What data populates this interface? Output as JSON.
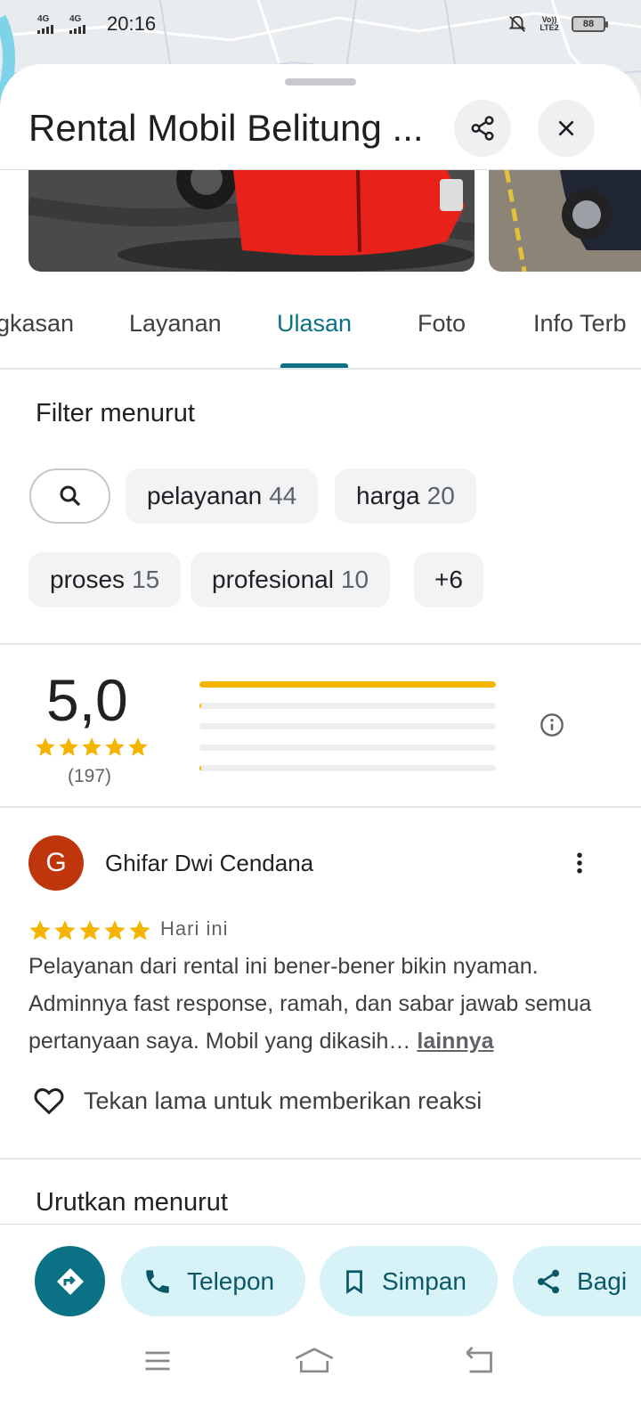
{
  "status_bar": {
    "net1": "4G",
    "net2": "4G",
    "time": "20:16",
    "volte": "Vo)) LTE2",
    "battery": "88"
  },
  "place": {
    "title": "Rental Mobil Belitung ..."
  },
  "tabs": [
    {
      "label": "gkasan"
    },
    {
      "label": "Layanan"
    },
    {
      "label": "Ulasan"
    },
    {
      "label": "Foto"
    },
    {
      "label": "Info Terb"
    }
  ],
  "filter": {
    "title": "Filter menurut",
    "chips": [
      {
        "label": "pelayanan",
        "count": "44"
      },
      {
        "label": "harga",
        "count": "20"
      },
      {
        "label": "proses",
        "count": "15"
      },
      {
        "label": "profesional",
        "count": "10"
      },
      {
        "label": "+6",
        "count": ""
      }
    ]
  },
  "rating": {
    "value": "5,0",
    "stars": 5,
    "count": "(197)",
    "distribution": [
      {
        "stars": 5,
        "fraction": 1.0
      },
      {
        "stars": 4,
        "fraction": 0.005
      },
      {
        "stars": 3,
        "fraction": 0.0
      },
      {
        "stars": 2,
        "fraction": 0.0
      },
      {
        "stars": 1,
        "fraction": 0.005
      }
    ],
    "bar_color": "#f4b400"
  },
  "review": {
    "avatar_letter": "G",
    "avatar_color": "#bf360c",
    "author": "Ghifar Dwi Cendana",
    "stars": 5,
    "date": "Hari ini",
    "text": "Pelayanan dari rental ini bener-bener bikin nyaman. Adminnya fast response, ramah, dan sabar jawab semua pertanyaan saya. Mobil yang dikasih…",
    "more_label": "lainnya",
    "reaction_hint": "Tekan lama untuk memberikan reaksi"
  },
  "sort": {
    "title": "Urutkan menurut"
  },
  "actions": {
    "call": "Telepon",
    "save": "Simpan",
    "share": "Bagi"
  },
  "colors": {
    "accent": "#0b7285",
    "pill_bg": "#d7f3f8",
    "star": "#f4b400"
  }
}
